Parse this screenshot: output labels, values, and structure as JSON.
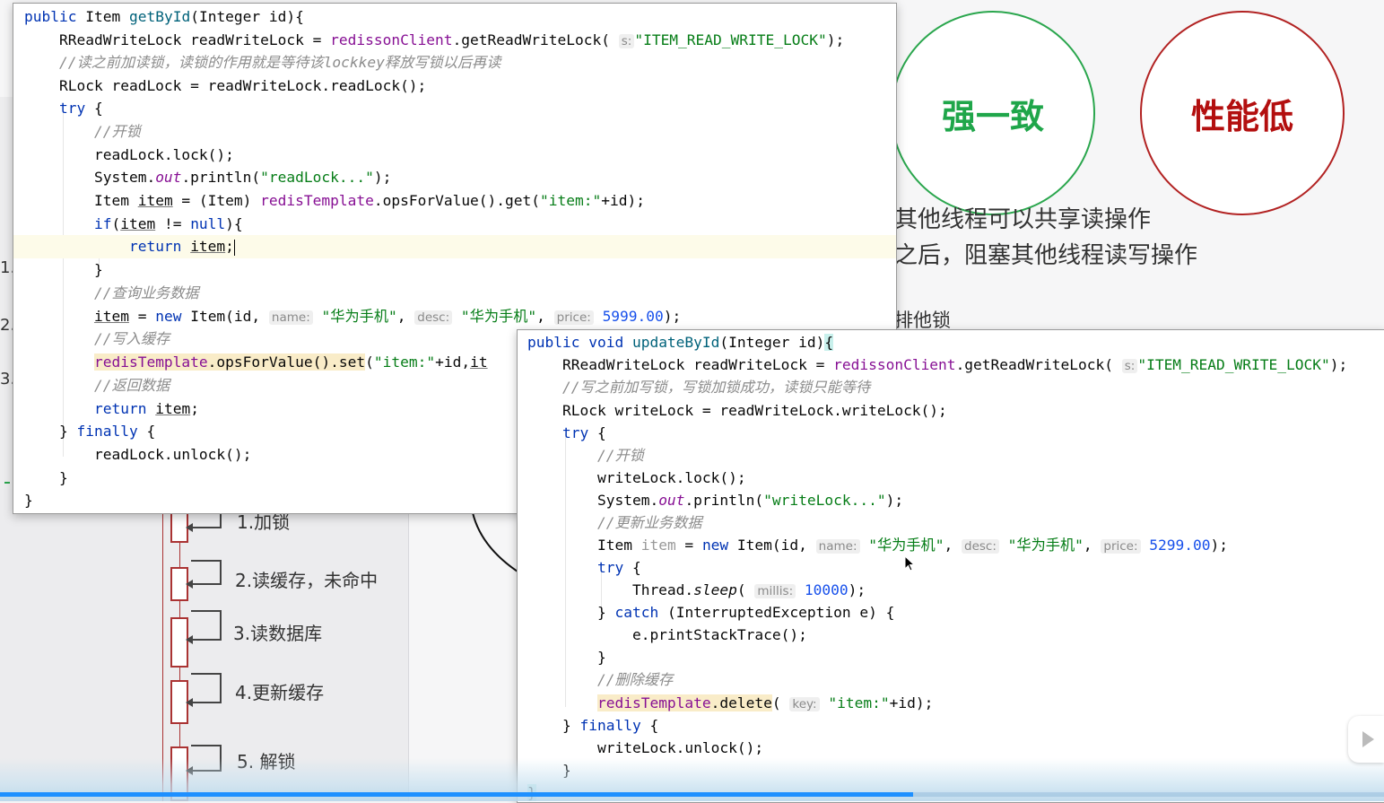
{
  "slide": {
    "circle_strong_consistency": "强一致",
    "circle_low_performance": "性能低",
    "text_line1": "其他线程可以共享读操作",
    "text_line2": "之后，阻塞其他线程读写操作",
    "text_line3": "排他锁",
    "edge_numbers": [
      "1.",
      "2.",
      "3."
    ],
    "diagram_steps": [
      "1.加锁",
      "2.读缓存，未命中",
      "3.读数据库",
      "4.更新缓存",
      "5. 解锁"
    ],
    "colors": {
      "green": "#1fa64a",
      "red": "#b30f0f"
    }
  },
  "code_window_read": {
    "method_name": "getById",
    "lock_name_hint": "s:",
    "lock_name": "\"ITEM_READ_WRITE_LOCK\"",
    "comment_read_lock": "//读之前加读锁，读锁的作用就是等待该lockkey释放写锁以后再读",
    "comment_lock": "//开锁",
    "print_string": "\"readLock...\"",
    "cache_key": "\"item:\"",
    "comment_query": "//查询业务数据",
    "hint_name": "name:",
    "item_name": "\"华为手机\"",
    "hint_desc": "desc:",
    "item_desc": "\"华为手机\"",
    "hint_price": "price:",
    "item_price": "5999.00",
    "comment_write_cache": "//写入缓存",
    "comment_return": "//返回数据"
  },
  "code_window_write": {
    "method_name": "updateById",
    "lock_name_hint": "s:",
    "lock_name": "\"ITEM_READ_WRITE_LOCK\"",
    "comment_write_lock": "//写之前加写锁，写锁加锁成功，读锁只能等待",
    "comment_lock": "//开锁",
    "print_string": "\"writeLock...\"",
    "comment_update": "//更新业务数据",
    "hint_name": "name:",
    "item_name": "\"华为手机\"",
    "hint_desc": "desc:",
    "item_desc": "\"华为手机\"",
    "hint_price": "price:",
    "item_price": "5299.00",
    "hint_millis": "millis:",
    "sleep_millis": "10000",
    "comment_delete_cache": "//删除缓存",
    "hint_key": "key:",
    "cache_key": "\"item:\""
  },
  "player": {
    "progress": 0.66,
    "play_icon": "play-icon"
  }
}
